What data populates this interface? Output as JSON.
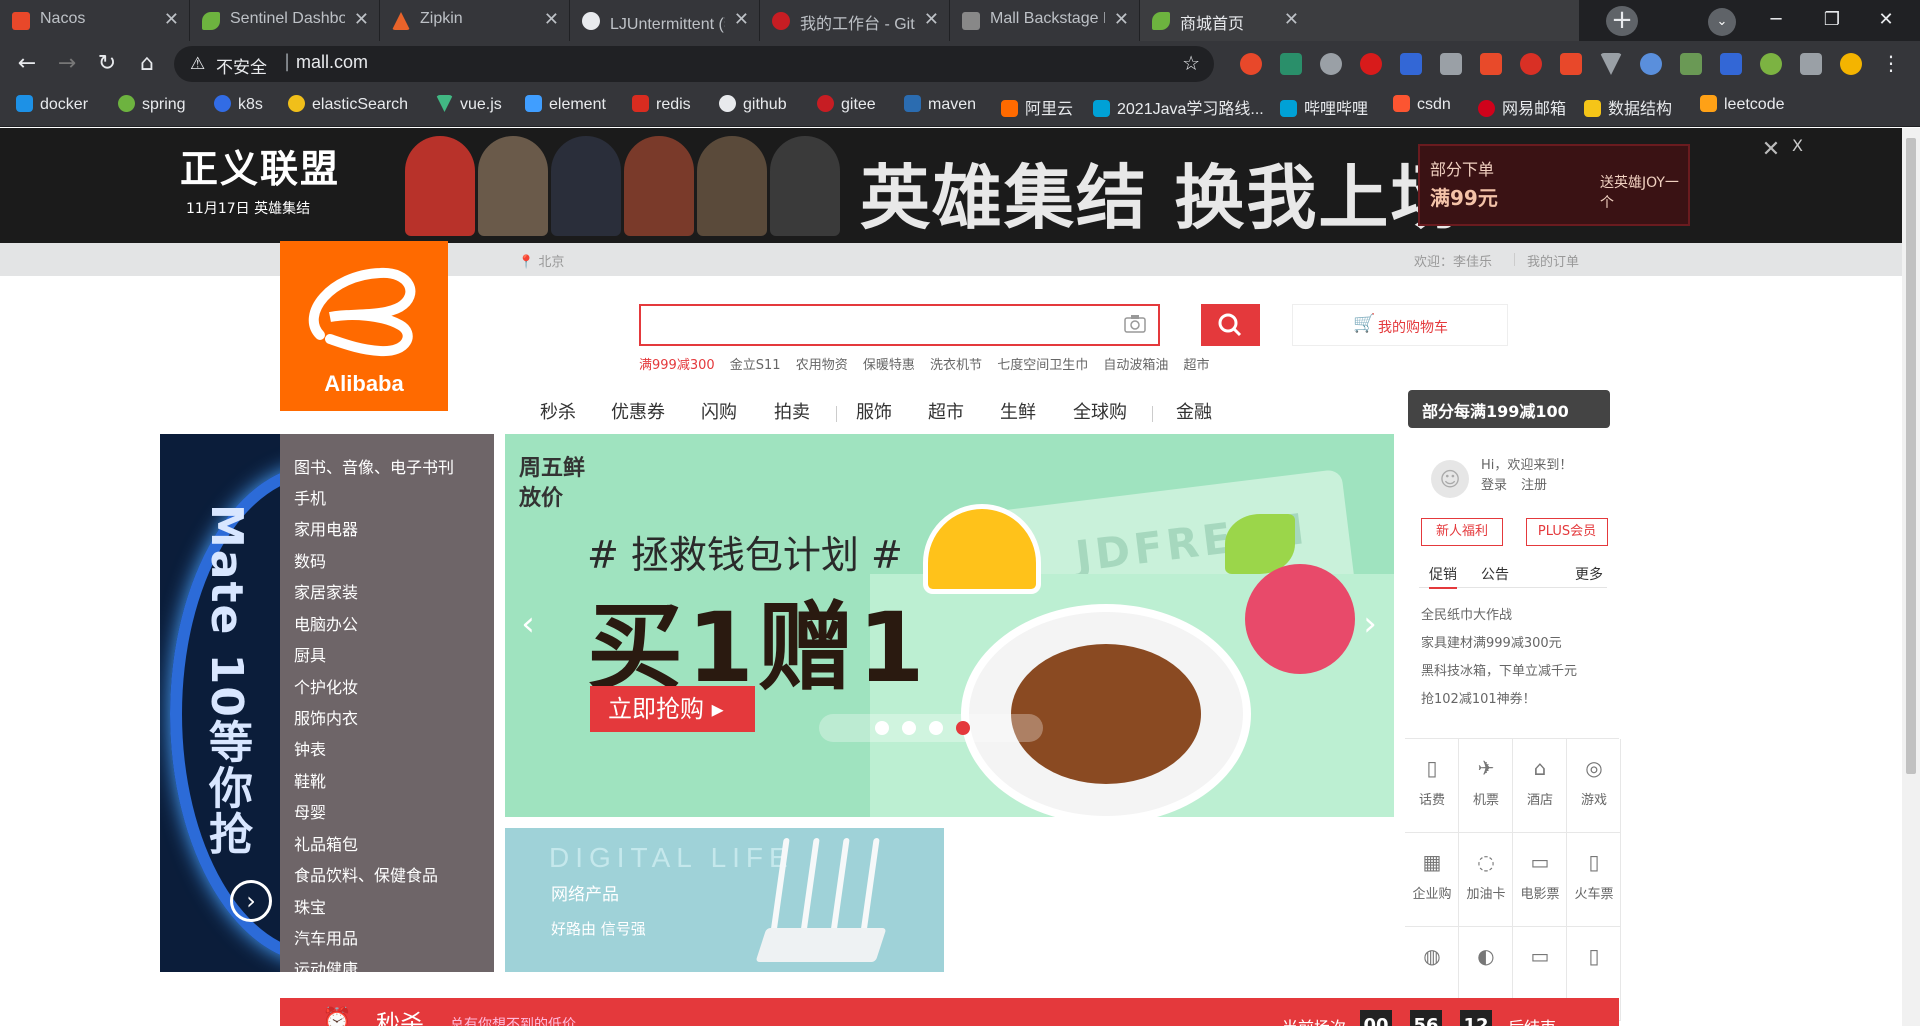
{
  "browser": {
    "tabs": [
      {
        "title": "Nacos",
        "color": "#e8482a"
      },
      {
        "title": "Sentinel Dashboard",
        "color": "#6db33f"
      },
      {
        "title": "Zipkin",
        "color": "#e8632a"
      },
      {
        "title": "LJUntermittent (李佳",
        "color": "#e8eaed"
      },
      {
        "title": "我的工作台 - Gitee.co",
        "color": "#c71d23"
      },
      {
        "title": "Mall Backstage Mar",
        "color": "#888888"
      },
      {
        "title": "商城首页",
        "color": "#6db33f"
      }
    ],
    "new_tab": "+",
    "address": {
      "insecure_label": "不安全",
      "url": "mall.com"
    },
    "bookmarks": [
      {
        "label": "docker",
        "color": "#1d91e6"
      },
      {
        "label": "spring",
        "color": "#6db33f"
      },
      {
        "label": "k8s",
        "color": "#326ce5"
      },
      {
        "label": "elasticSearch",
        "color": "#f0bf1a"
      },
      {
        "label": "vue.js",
        "color": "#41b883"
      },
      {
        "label": "element",
        "color": "#409eff"
      },
      {
        "label": "redis",
        "color": "#d82c20"
      },
      {
        "label": "github",
        "color": "#e8eaed"
      },
      {
        "label": "gitee",
        "color": "#c71d23"
      },
      {
        "label": "maven",
        "color": "#2b6cb0"
      },
      {
        "label": "阿里云",
        "color": "#ff6a00"
      },
      {
        "label": "2021Java学习路线...",
        "color": "#00a1d6"
      },
      {
        "label": "哔哩哔哩",
        "color": "#00a1d6"
      },
      {
        "label": "csdn",
        "color": "#fc5531"
      },
      {
        "label": "网易邮箱",
        "color": "#d0021b"
      },
      {
        "label": "数据结构",
        "color": "#f5c518"
      },
      {
        "label": "leetcode",
        "color": "#ffa116"
      }
    ]
  },
  "page": {
    "top_banner": {
      "left_title": "正义联盟",
      "left_date": "11月17日 英雄集结",
      "slogan": "英雄集结 换我上场",
      "promo_1": "部分下单",
      "promo_2": "满99元",
      "promo_3": "送英雄JOY一个",
      "close": "✕",
      "x": "X"
    },
    "utility": {
      "location": "北京",
      "welcome": "欢迎：李佳乐",
      "orders": "我的订单"
    },
    "logo_text": "Alibaba",
    "search": {
      "placeholder": "",
      "hotwords": [
        "满999减300",
        "金立S11",
        "农用物资",
        "保暖特惠",
        "洗衣机节",
        "七度空间卫生巾",
        "自动波箱油",
        "超市"
      ]
    },
    "cart_label": "我的购物车",
    "nav": [
      "秒杀",
      "优惠券",
      "闪购",
      "拍卖",
      "服饰",
      "超市",
      "生鲜",
      "全球购",
      "金融"
    ],
    "nav_promo": "部分每满199减100",
    "side_ad": "Mate 10等你抢",
    "categories": [
      "图书、音像、电子书刊",
      "手机",
      "家用电器",
      "数码",
      "家居家装",
      "电脑办公",
      "厨具",
      "个护化妆",
      "服饰内衣",
      "钟表",
      "鞋靴",
      "母婴",
      "礼品箱包",
      "食品饮料、保健食品",
      "珠宝",
      "汽车用品",
      "运动健康"
    ],
    "carousel": {
      "tag": "周五鲜放价",
      "plan": "# 拯救钱包计划 #",
      "headline": "买1赠1",
      "cta": "立即抢购 ▸",
      "card_text": "JDFRESH",
      "active_dot": 3,
      "dot_count": 4
    },
    "digital": {
      "en": "DIGITAL LIFE",
      "title": "网络产品",
      "sub": "好路由 信号强"
    },
    "user_panel": {
      "hi": "Hi，欢迎来到！",
      "login": "登录",
      "register": "注册",
      "new_user": "新人福利",
      "plus": "PLUS会员"
    },
    "news_tabs": [
      "促销",
      "公告",
      "更多"
    ],
    "news": [
      "全民纸巾大作战",
      "家具建材满999减300元",
      "黑科技冰箱，下单立减千元",
      "抢102减101神券！"
    ],
    "services": [
      {
        "label": "话费",
        "icon": "phone-bill-icon",
        "glyph": "▯"
      },
      {
        "label": "机票",
        "icon": "airplane-icon",
        "glyph": "✈"
      },
      {
        "label": "酒店",
        "icon": "hotel-icon",
        "glyph": "⌂"
      },
      {
        "label": "游戏",
        "icon": "gamepad-icon",
        "glyph": "◎"
      },
      {
        "label": "企业购",
        "icon": "enterprise-icon",
        "glyph": "▦"
      },
      {
        "label": "加油卡",
        "icon": "fuel-card-icon",
        "glyph": "◌"
      },
      {
        "label": "电影票",
        "icon": "movie-ticket-icon",
        "glyph": "▭"
      },
      {
        "label": "火车票",
        "icon": "train-ticket-icon",
        "glyph": "▯"
      },
      {
        "label": "",
        "icon": "service-icon",
        "glyph": "◍"
      },
      {
        "label": "",
        "icon": "service-icon",
        "glyph": "◐"
      },
      {
        "label": "",
        "icon": "service-icon",
        "glyph": "▭"
      },
      {
        "label": "",
        "icon": "service-icon",
        "glyph": "▯"
      }
    ],
    "seckill": {
      "title": "秒杀",
      "sub": "总有你想不到的低价",
      "current": "当前场次",
      "countdown": [
        "00",
        "56",
        "12"
      ],
      "after": "后结束"
    }
  }
}
